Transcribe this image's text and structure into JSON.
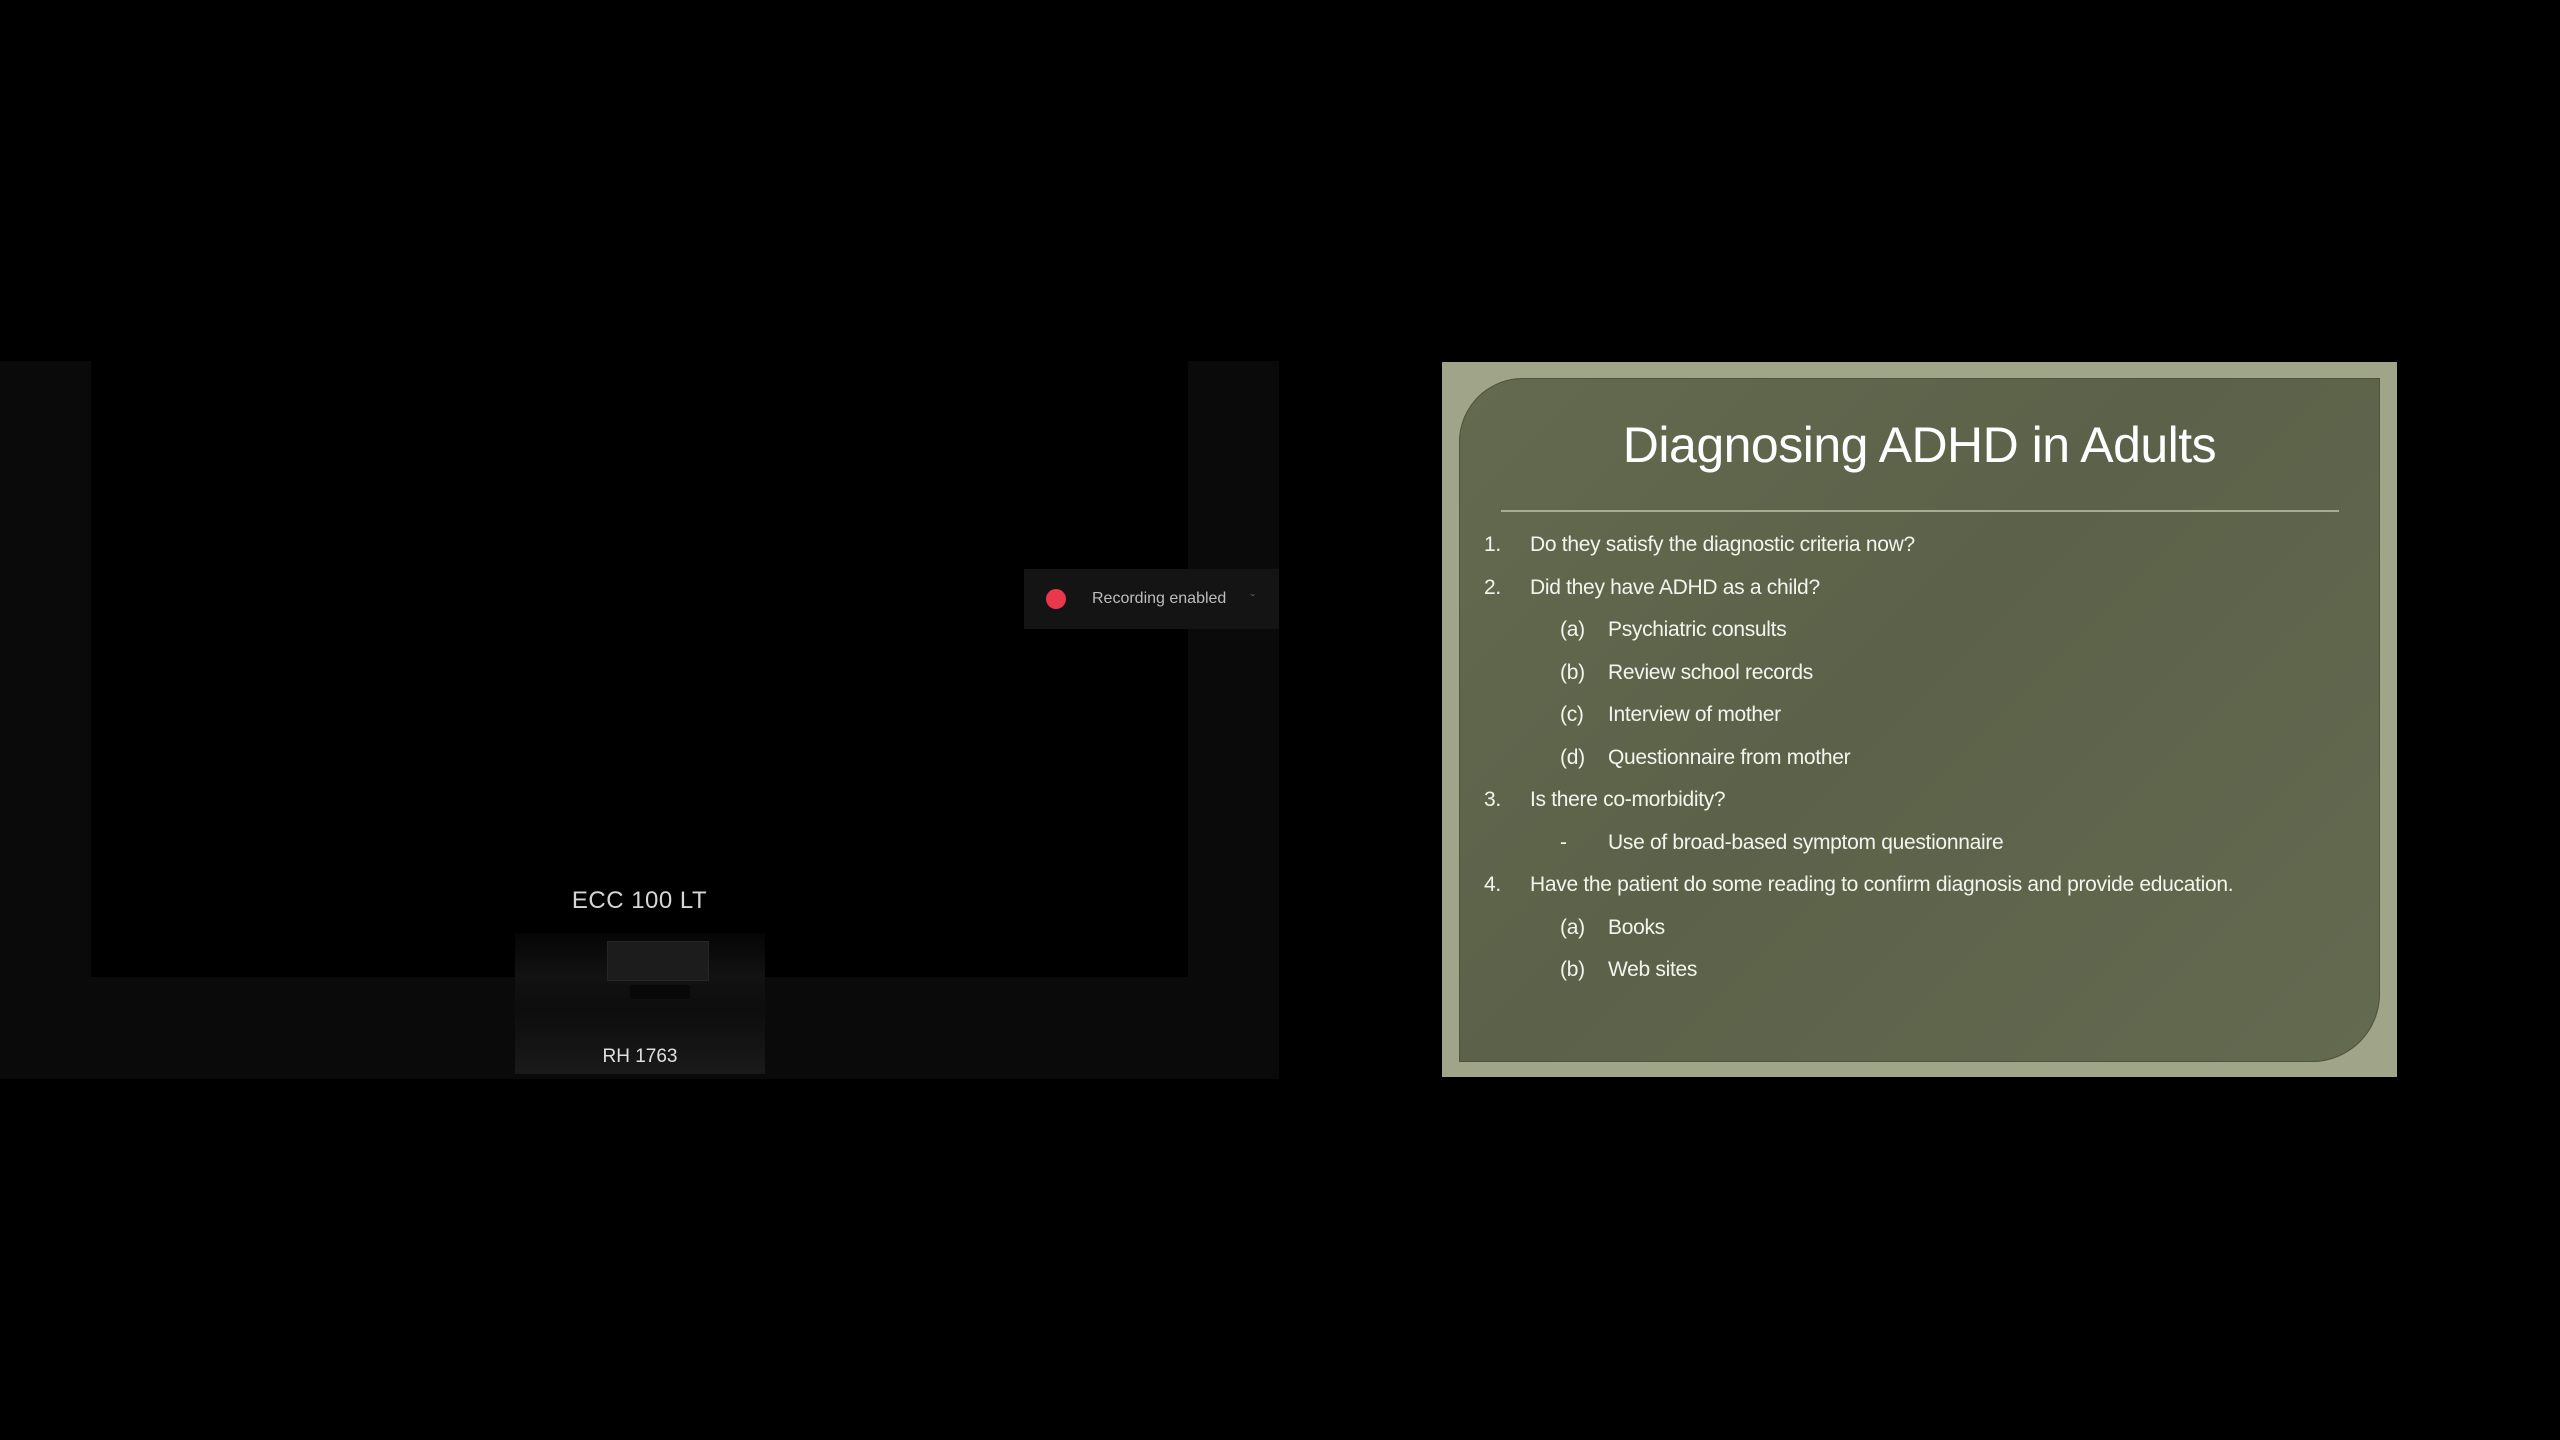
{
  "video": {
    "room_label": "ECC 100 LT",
    "thumbnail_label": "RH 1763",
    "recording_text": "Recording enabled",
    "recording_dismiss": "ˇ",
    "recording_color": "#e8384a"
  },
  "slide": {
    "title": "Diagnosing ADHD in Adults",
    "items": [
      {
        "marker": "1.",
        "text": "Do they satisfy the diagnostic criteria now?",
        "level": 1
      },
      {
        "marker": "2.",
        "text": "Did they have ADHD as a child?",
        "level": 1
      },
      {
        "marker": "(a)",
        "text": "Psychiatric consults",
        "level": 2
      },
      {
        "marker": "(b)",
        "text": "Review school records",
        "level": 2
      },
      {
        "marker": "(c)",
        "text": "Interview of mother",
        "level": 2
      },
      {
        "marker": "(d)",
        "text": "Questionnaire from mother",
        "level": 2
      },
      {
        "marker": "3.",
        "text": "Is there co-morbidity?",
        "level": 1
      },
      {
        "marker": "-",
        "text": "Use of broad-based symptom questionnaire",
        "level": 2
      },
      {
        "marker": "4.",
        "text": "Have the patient do some reading to confirm diagnosis and provide education.",
        "level": 1
      },
      {
        "marker": "(a)",
        "text": "Books",
        "level": 2
      },
      {
        "marker": "(b)",
        "text": "Web sites",
        "level": 2
      }
    ]
  }
}
